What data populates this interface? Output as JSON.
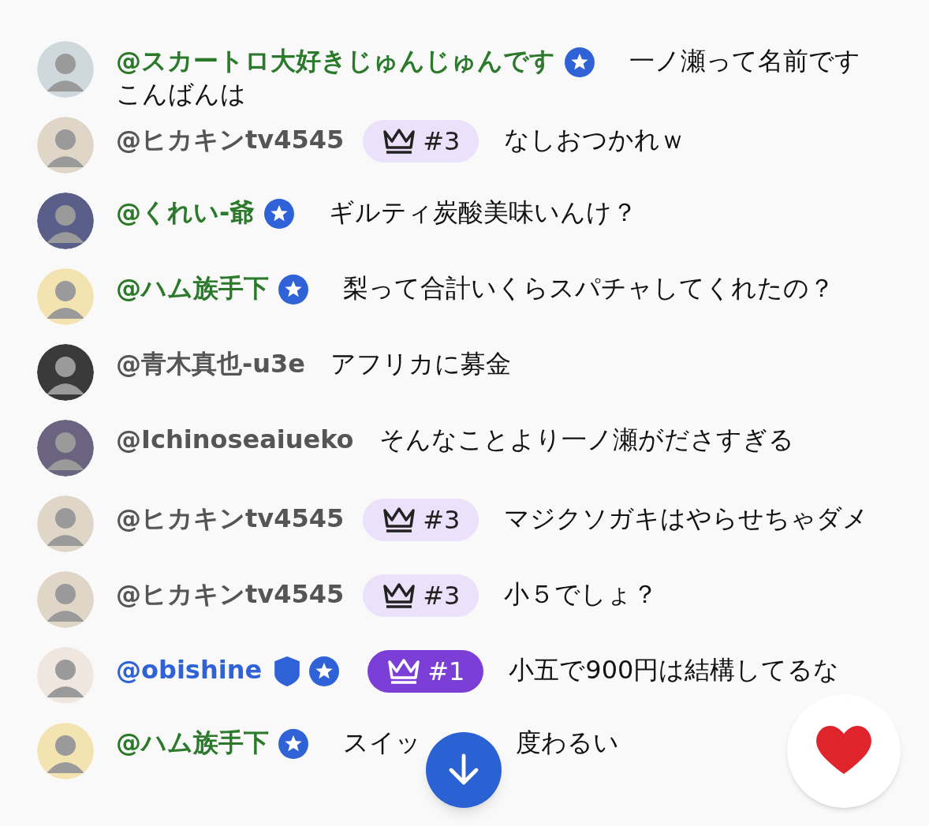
{
  "messages": [
    {
      "author": "@スカートロ大好きじゅんじゅんです",
      "kind": "member",
      "member": true,
      "moderator": false,
      "message": "一ノ瀬って名前です",
      "message_continued": "こんばんは"
    },
    {
      "author": "@ヒカキンtv4545",
      "kind": "regular",
      "member": false,
      "moderator": false,
      "rank": {
        "label": "#3",
        "top": false
      },
      "message": "なしおつかれｗ"
    },
    {
      "author": "@くれい-爺",
      "kind": "member",
      "member": true,
      "moderator": false,
      "message": "ギルティ炭酸美味いんけ？"
    },
    {
      "author": "@ハム族手下",
      "kind": "member",
      "member": true,
      "moderator": false,
      "message": "梨って合計いくらスパチャしてくれたの？"
    },
    {
      "author": "@青木真也-u3e",
      "kind": "regular",
      "member": false,
      "moderator": false,
      "message": "アフリカに募金"
    },
    {
      "author": "@Ichinoseaiueko",
      "kind": "regular",
      "member": false,
      "moderator": false,
      "message": "そんなことより一ノ瀬がださすぎる"
    },
    {
      "author": "@ヒカキンtv4545",
      "kind": "regular",
      "member": false,
      "moderator": false,
      "rank": {
        "label": "#3",
        "top": false
      },
      "message": "マジクソガキはやらせちゃダメ"
    },
    {
      "author": "@ヒカキンtv4545",
      "kind": "regular",
      "member": false,
      "moderator": false,
      "rank": {
        "label": "#3",
        "top": false
      },
      "message": "小５でしょ？"
    },
    {
      "author": "@obishine",
      "kind": "moderator",
      "member": true,
      "moderator": true,
      "rank": {
        "label": "#1",
        "top": true
      },
      "message": "小五で900円は結構してるな"
    },
    {
      "author": "@ハム族手下",
      "kind": "member",
      "member": true,
      "moderator": false,
      "message": "スイッ",
      "message_after_cover": "度わるい"
    }
  ]
}
